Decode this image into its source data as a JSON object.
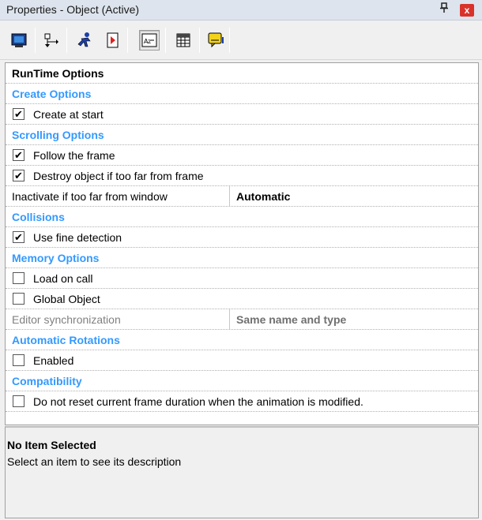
{
  "window": {
    "title": "Properties - Object (Active)",
    "pin_glyph": "▐",
    "close_glyph": "x"
  },
  "toolbar": {
    "buttons": [
      {
        "name": "display-icon",
        "pressed": false
      },
      {
        "name": "size-position-icon",
        "pressed": false
      },
      {
        "name": "movement-icon",
        "pressed": false
      },
      {
        "name": "runtime-options-icon",
        "pressed": true
      },
      {
        "name": "sort-az-icon",
        "pressed": false
      },
      {
        "name": "grid-view-icon",
        "pressed": false
      },
      {
        "name": "about-icon",
        "pressed": false
      }
    ],
    "sort_label": "A-Z"
  },
  "grid": {
    "header": "RunTime Options",
    "create_options": {
      "label": "Create Options",
      "create_at_start": {
        "label": "Create at start",
        "checked": true
      }
    },
    "scrolling_options": {
      "label": "Scrolling Options",
      "follow_frame": {
        "label": "Follow the frame",
        "checked": true
      },
      "destroy_far": {
        "label": "Destroy object if too far from frame",
        "checked": true
      },
      "inactivate": {
        "label": "Inactivate if too far from window",
        "value": "Automatic"
      }
    },
    "collisions": {
      "label": "Collisions",
      "fine_detection": {
        "label": "Use fine detection",
        "checked": true
      }
    },
    "memory_options": {
      "label": "Memory Options",
      "load_on_call": {
        "label": "Load on call",
        "checked": false
      },
      "global_object": {
        "label": "Global Object",
        "checked": false
      },
      "editor_sync": {
        "label": "Editor synchronization",
        "value": "Same name and type"
      }
    },
    "automatic_rotations": {
      "label": "Automatic Rotations",
      "enabled": {
        "label": "Enabled",
        "checked": false
      }
    },
    "compatibility": {
      "label": "Compatibility",
      "no_reset": {
        "label": "Do not reset current frame duration when the animation is modified.",
        "checked": false
      }
    }
  },
  "description": {
    "title": "No Item Selected",
    "text": "Select an item to see its description"
  },
  "colors": {
    "category": "#3399ff",
    "close_button": "#d9322a",
    "titlebar": "#dde4ed"
  }
}
